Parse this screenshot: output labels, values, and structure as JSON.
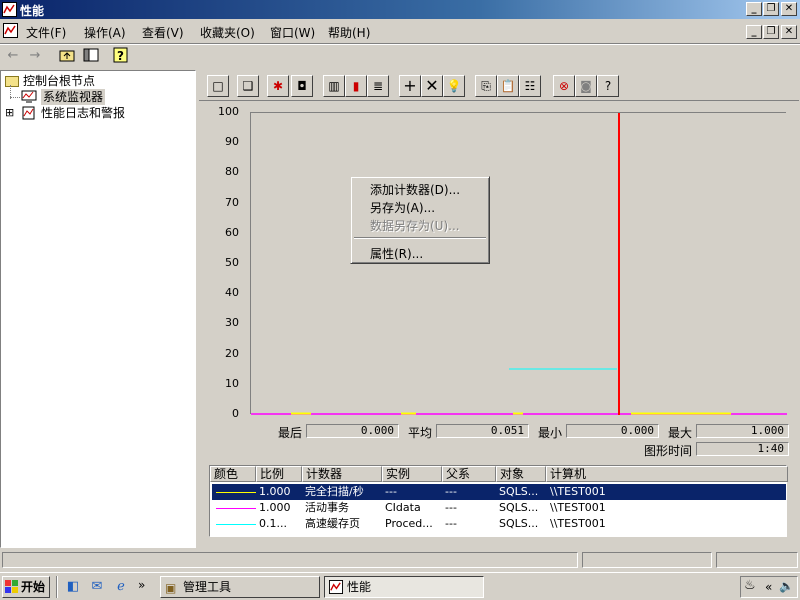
{
  "window": {
    "title": "性能"
  },
  "menubar": {
    "items": [
      "文件(F)",
      "操作(A)",
      "查看(V)",
      "收藏夹(O)",
      "窗口(W)",
      "帮助(H)"
    ]
  },
  "tree": {
    "items": [
      {
        "label": "控制台根节点",
        "icon": "folder-icon"
      },
      {
        "label": "系统监视器",
        "icon": "monitor-icon",
        "selected": true
      },
      {
        "label": "性能日志和警报",
        "icon": "log-icon",
        "expander": "⊞"
      }
    ]
  },
  "chart_data": {
    "type": "line",
    "y_ticks": [
      "100",
      "90",
      "80",
      "70",
      "60",
      "50",
      "40",
      "30",
      "20",
      "10",
      "0"
    ],
    "ylim": [
      0,
      100
    ],
    "grid": false,
    "series": [
      {
        "name": "完全扫描/秒",
        "color": "#ffff00",
        "values": [
          0,
          0,
          0,
          0
        ]
      },
      {
        "name": "活动事务",
        "color": "#ff00ff",
        "values": [
          0,
          0,
          0,
          0
        ]
      },
      {
        "name": "高速缓存页",
        "color": "#00ffff",
        "segment_value": 15
      }
    ],
    "time_bar_color": "#ff0000"
  },
  "stats": {
    "last_label": "最后",
    "last_value": "0.000",
    "avg_label": "平均",
    "avg_value": "0.051",
    "min_label": "最小",
    "min_value": "0.000",
    "max_label": "最大",
    "max_value": "1.000",
    "duration_label": "图形时间",
    "duration_value": "1:40"
  },
  "legend": {
    "headers": [
      "颜色",
      "比例",
      "计数器",
      "实例",
      "父系",
      "对象",
      "计算机"
    ],
    "rows": [
      {
        "color": "#ffff00",
        "scale": "1.000",
        "counter": "完全扫描/秒",
        "instance": "---",
        "parent": "---",
        "object": "SQLS...",
        "computer": "\\\\TEST001",
        "selected": true
      },
      {
        "color": "#ff00ff",
        "scale": "1.000",
        "counter": "活动事务",
        "instance": "CIdata",
        "parent": "---",
        "object": "SQLS...",
        "computer": "\\\\TEST001",
        "selected": false
      },
      {
        "color": "#00ffff",
        "scale": "0.1...",
        "counter": "高速缓存页",
        "instance": "Proced...",
        "parent": "---",
        "object": "SQLS...",
        "computer": "\\\\TEST001",
        "selected": false
      }
    ]
  },
  "context_menu": {
    "add_counters": "添加计数器(D)...",
    "save_as": "另存为(A)...",
    "save_data_as": "数据另存为(U)...",
    "properties": "属性(R)..."
  },
  "taskbar": {
    "start": "开始",
    "tasks": [
      "管理工具",
      "性能"
    ],
    "quick_launch_chevron": "»",
    "tray_chevron": "«"
  }
}
